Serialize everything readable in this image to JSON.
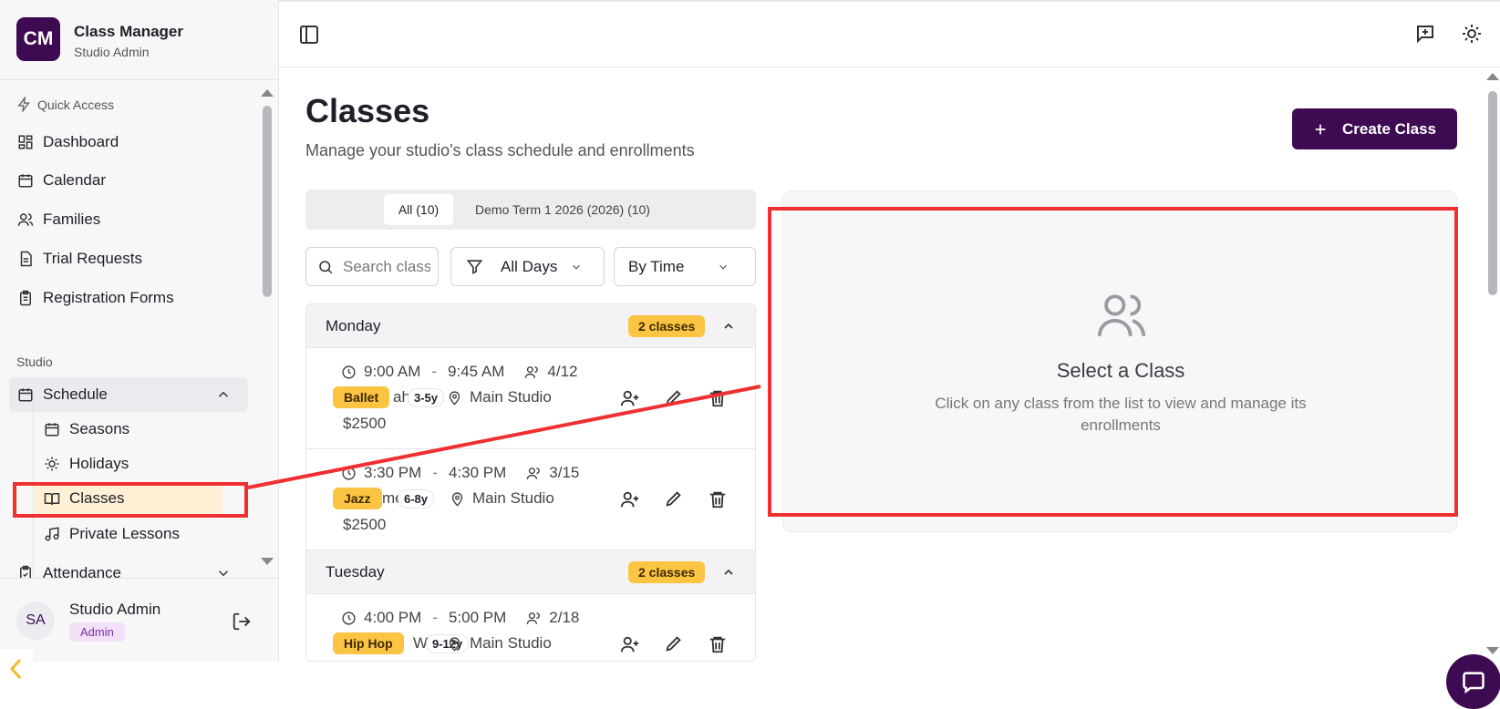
{
  "app": {
    "logo": "CM",
    "title": "Class Manager",
    "subtitle": "Studio Admin"
  },
  "sidebar": {
    "quick_access_label": "Quick Access",
    "quick_items": [
      {
        "label": "Dashboard",
        "icon": "dashboard-icon"
      },
      {
        "label": "Calendar",
        "icon": "calendar-icon"
      },
      {
        "label": "Families",
        "icon": "users-icon"
      },
      {
        "label": "Trial Requests",
        "icon": "document-icon"
      },
      {
        "label": "Registration Forms",
        "icon": "clipboard-icon"
      }
    ],
    "studio_label": "Studio",
    "schedule_label": "Schedule",
    "schedule_items": [
      {
        "label": "Seasons",
        "icon": "calendar-icon"
      },
      {
        "label": "Holidays",
        "icon": "sun-icon"
      },
      {
        "label": "Classes",
        "icon": "book-icon",
        "selected": true
      },
      {
        "label": "Private Lessons",
        "icon": "music-icon"
      }
    ],
    "attendance_label": "Attendance"
  },
  "user": {
    "initials": "SA",
    "name": "Studio Admin",
    "role": "Admin"
  },
  "page": {
    "title": "Classes",
    "subtitle": "Manage your studio's class schedule and enrollments",
    "create_button": "Create Class"
  },
  "tabs": [
    {
      "label": "All (10)",
      "active": true
    },
    {
      "label": "Demo Term 1 2026 (2026) (10)",
      "active": false
    }
  ],
  "filters": {
    "search_placeholder": "Search classes",
    "day_filter": "All Days",
    "sort": "By Time"
  },
  "schedule": [
    {
      "day": "Monday",
      "count": "2 classes",
      "classes": [
        {
          "start": "9:00 AM",
          "end": "9:45 AM",
          "enrolled": "4/12",
          "style": "Ballet",
          "name": "Tiny Toes Ballet",
          "name_partial": "ah M",
          "age": "3-5y",
          "location": "Main Studio",
          "price": "$2500"
        },
        {
          "start": "3:30 PM",
          "end": "4:30 PM",
          "enrolled": "3/15",
          "style": "Jazz",
          "name": "Jazz Games",
          "name_partial": "mes",
          "age": "6-8y",
          "location": "Main Studio",
          "price": "$2500"
        }
      ]
    },
    {
      "day": "Tuesday",
      "count": "2 classes",
      "classes": [
        {
          "start": "4:00 PM",
          "end": "5:00 PM",
          "enrolled": "2/18",
          "style": "Hip Hop",
          "name": "Hip Hop W",
          "name_partial": "W",
          "age": "9-12y",
          "location": "Main Studio",
          "price": ""
        }
      ]
    }
  ],
  "detail": {
    "title": "Select a Class",
    "text": "Click on any class from the list to view and manage its enrollments"
  },
  "colors": {
    "brand": "#3e0a52",
    "badge": "#fcc443",
    "annotation": "#f03030"
  }
}
